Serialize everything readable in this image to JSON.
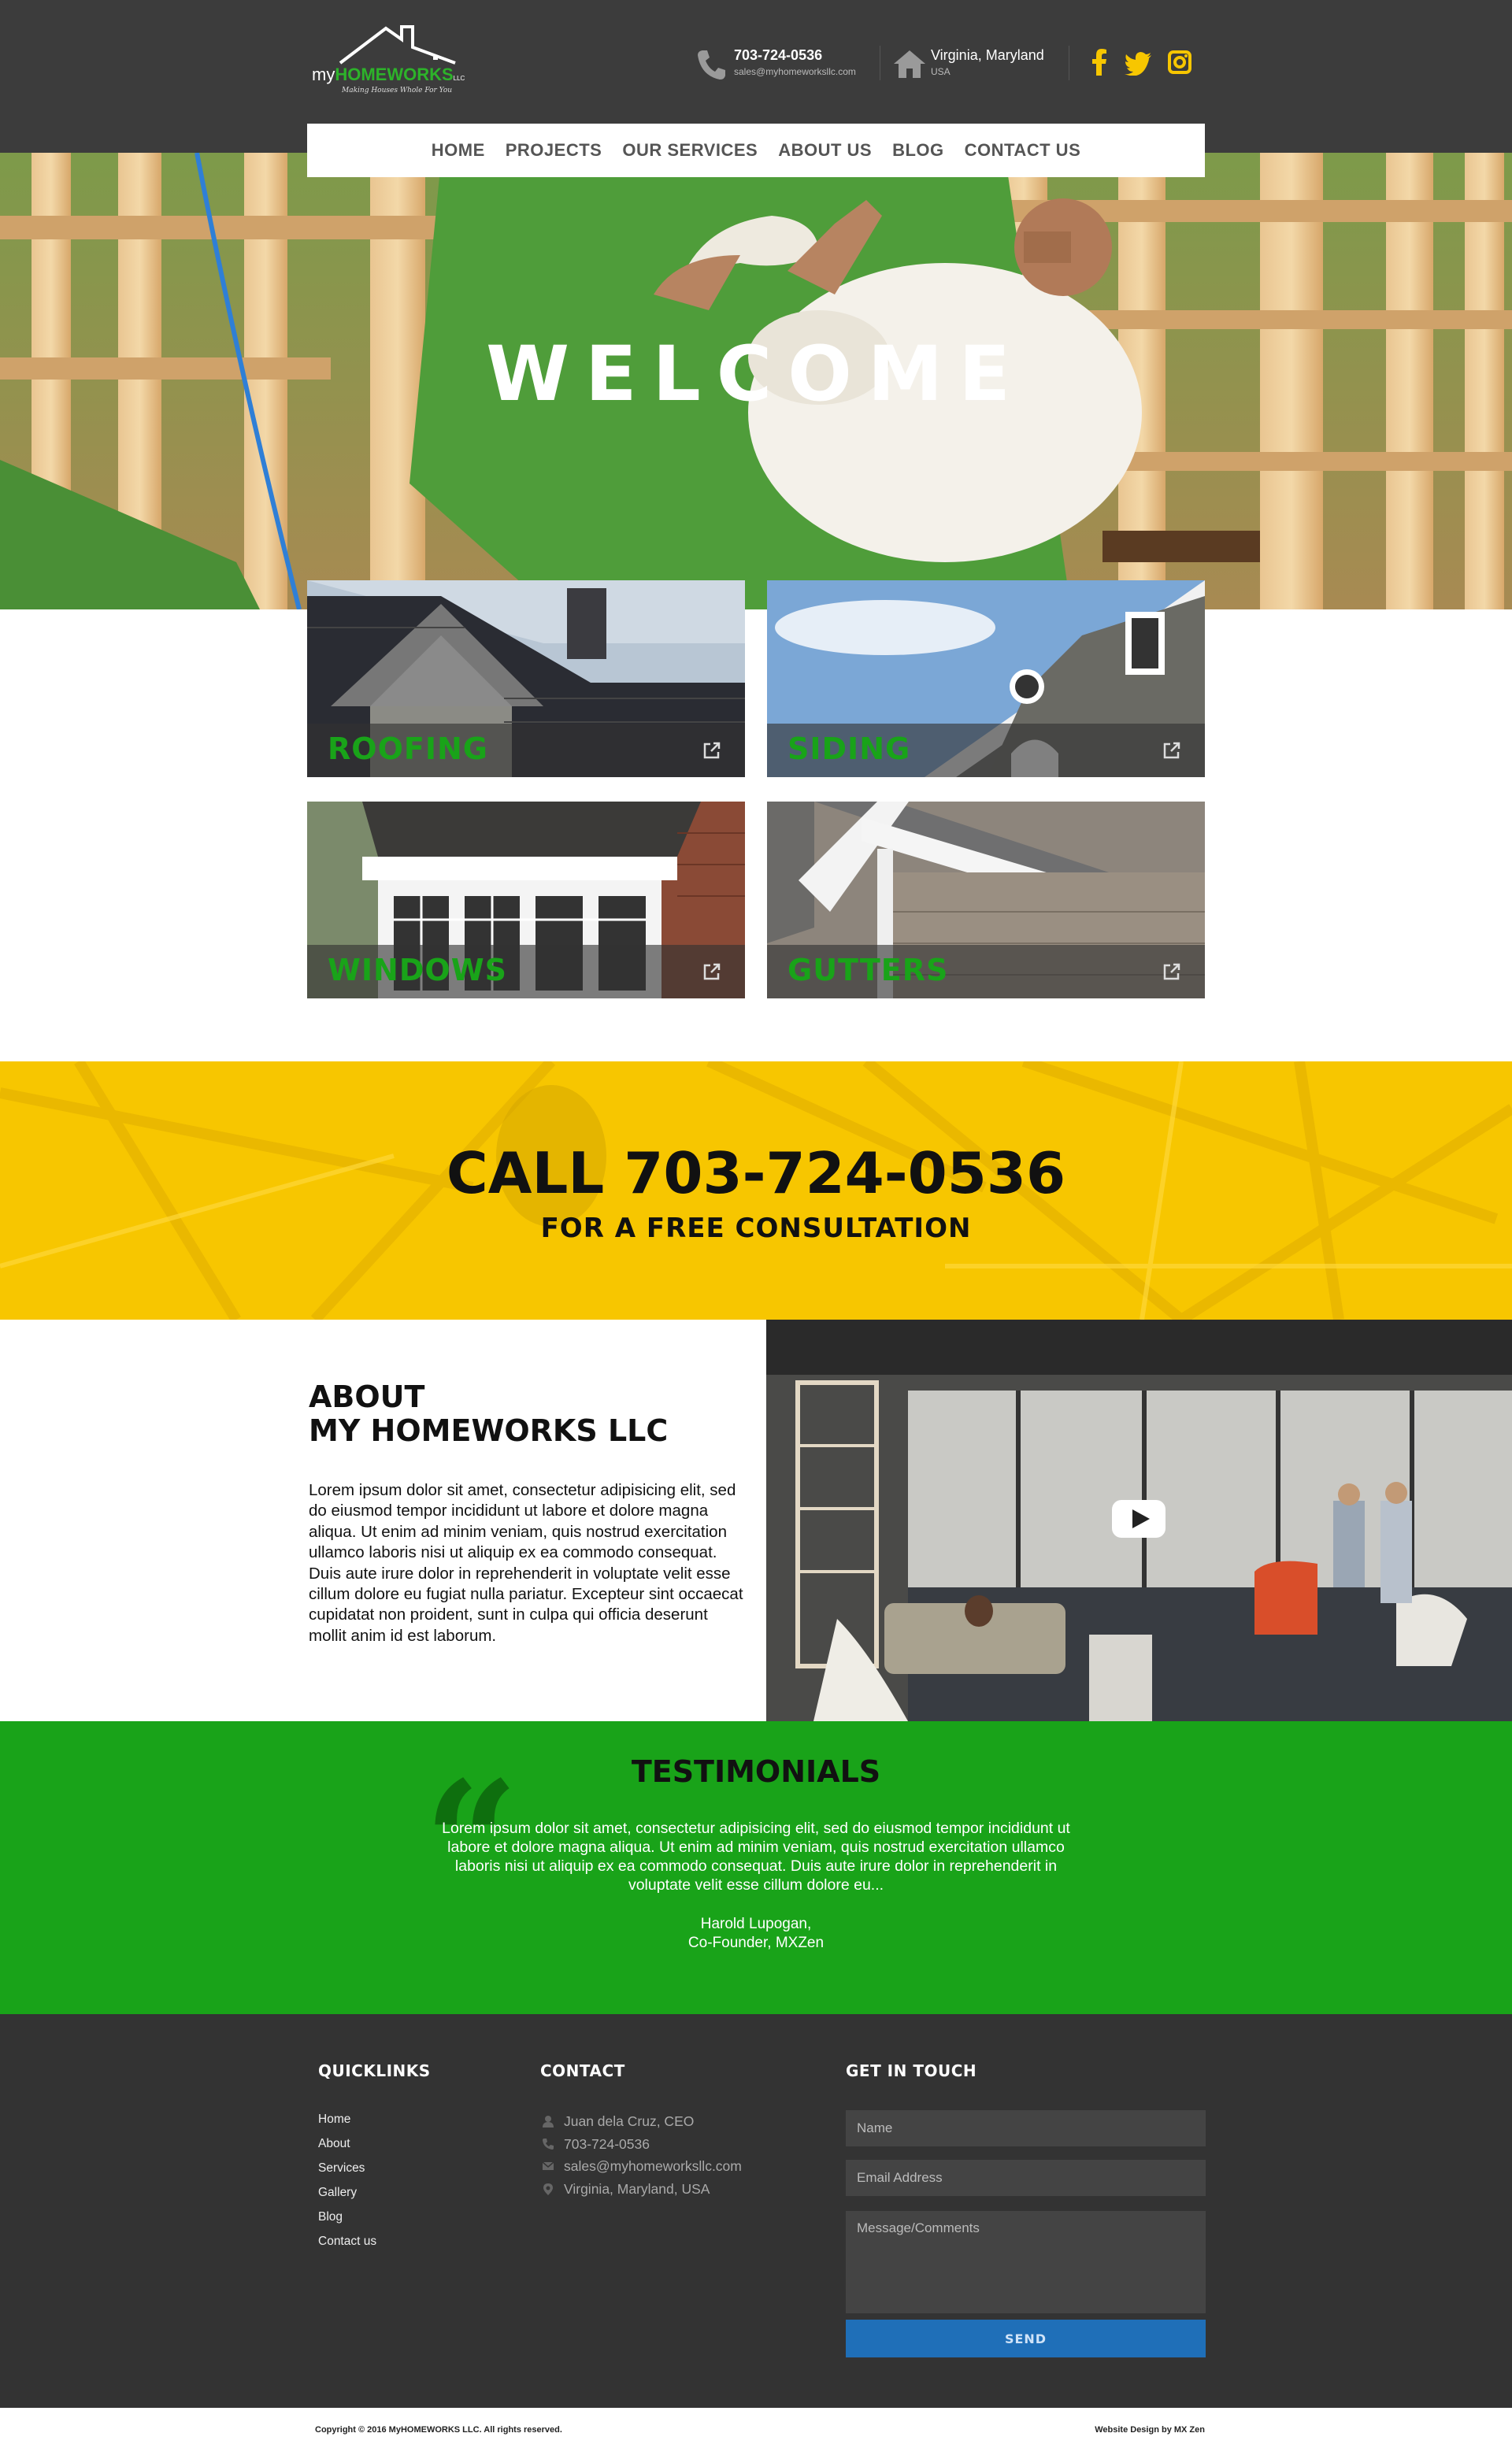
{
  "brand": {
    "logo_prefix": "my",
    "logo_name": "HOMEWORKS",
    "logo_suffix": "LLC",
    "tagline": "Making Houses Whole For You"
  },
  "header": {
    "phone": "703-724-0536",
    "email": "sales@myhomeworksllc.com",
    "location": "Virginia, Maryland",
    "country": "USA",
    "social": [
      "facebook-icon",
      "twitter-icon",
      "instagram-icon"
    ],
    "accent_color": "#f7c600"
  },
  "nav": {
    "items": [
      "HOME",
      "PROJECTS",
      "OUR SERVICES",
      "ABOUT US",
      "BLOG",
      "CONTACT US"
    ]
  },
  "hero": {
    "title": "WELCOME"
  },
  "services": [
    {
      "label": "ROOFING"
    },
    {
      "label": "SIDING"
    },
    {
      "label": "WINDOWS"
    },
    {
      "label": "GUTTERS"
    }
  ],
  "call": {
    "title": "CALL 703-724-0536",
    "subtitle": "FOR A FREE CONSULTATION"
  },
  "about": {
    "title_line1": "ABOUT",
    "title_line2": "MY HOMEWORKS LLC",
    "body": "Lorem ipsum dolor sit amet, consectetur adipisicing elit, sed do eiusmod tempor incididunt ut labore et dolore magna aliqua. Ut enim ad minim veniam, quis nostrud exercitation ullamco laboris nisi ut aliquip ex ea commodo consequat. Duis aute irure dolor in reprehenderit in voluptate velit esse cillum dolore eu fugiat nulla pariatur. Excepteur sint occaecat cupidatat non proident, sunt in culpa qui officia deserunt mollit anim id est laborum."
  },
  "testimonials": {
    "title": "TESTIMONIALS",
    "quote": "Lorem ipsum dolor sit amet, consectetur adipisicing elit, sed do eiusmod tempor incididunt ut labore et dolore magna aliqua. Ut enim ad minim veniam, quis nostrud exercitation ullamco laboris nisi ut aliquip ex ea commodo consequat. Duis aute irure dolor in reprehenderit in voluptate velit esse cillum dolore eu...",
    "author": "Harold Lupogan,",
    "role": "Co-Founder, MXZen",
    "bg_color": "#19a319"
  },
  "footer": {
    "quicklinks_title": "QUICKLINKS",
    "quicklinks": [
      "Home",
      "About",
      "Services",
      "Gallery",
      "Blog",
      "Contact us"
    ],
    "contact_title": "CONTACT",
    "contact": {
      "person": "Juan dela Cruz, CEO",
      "phone": "703-724-0536",
      "email": "sales@myhomeworksllc.com",
      "address": "Virginia, Maryland, USA"
    },
    "touch_title": "GET IN TOUCH",
    "form": {
      "name_placeholder": "Name",
      "email_placeholder": "Email Address",
      "message_placeholder": "Message/Comments",
      "send_label": "SEND"
    }
  },
  "bottom": {
    "copyright": "Copyright © 2016 MyHOMEWORKS LLC. All rights reserved.",
    "credit": "Website Design by MX Zen"
  }
}
